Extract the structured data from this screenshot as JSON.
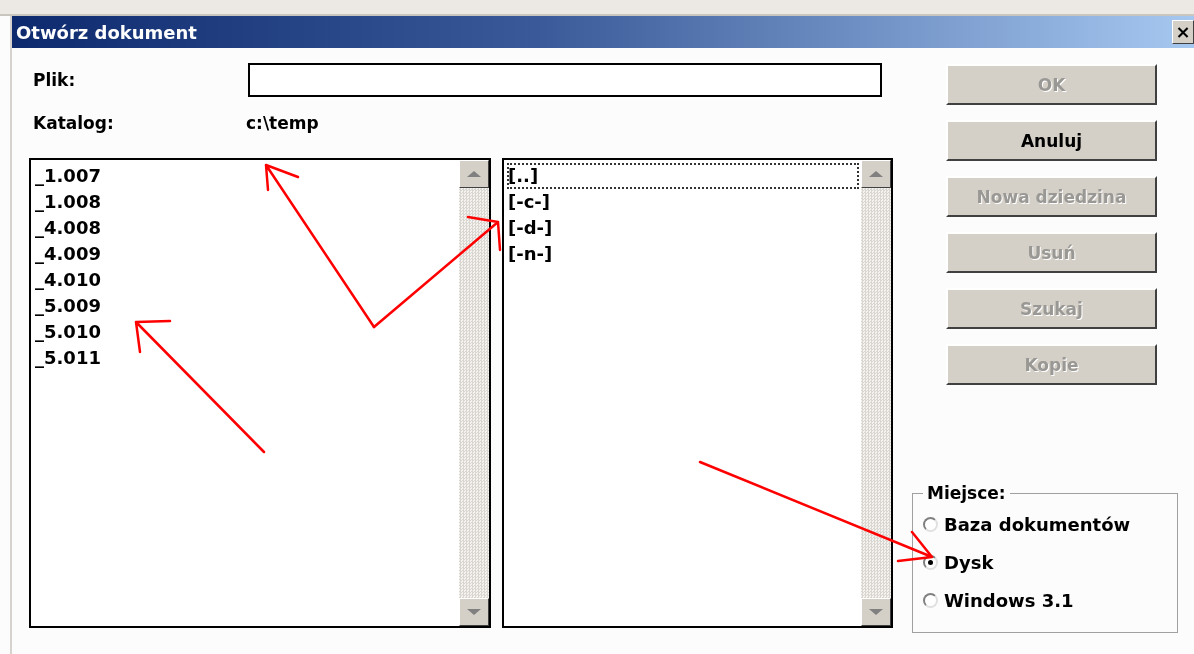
{
  "window": {
    "title": "Otwórz dokument",
    "close": "×"
  },
  "file": {
    "label": "Plik:"
  },
  "directory": {
    "label": "Katalog:",
    "path": "c:\\temp"
  },
  "files": [
    {
      "name": "_1.007",
      "selected": false
    },
    {
      "name": "_1.008",
      "selected": false
    },
    {
      "name": "_4.008",
      "selected": false
    },
    {
      "name": "_4.009",
      "selected": false
    },
    {
      "name": "_4.010",
      "selected": false
    },
    {
      "name": "_5.009",
      "selected": false
    },
    {
      "name": "_5.010",
      "selected": false
    },
    {
      "name": "_5.011",
      "selected": false
    }
  ],
  "directories": [
    {
      "name": "[..]",
      "selected": true
    },
    {
      "name": "[-c-]",
      "selected": false
    },
    {
      "name": "[-d-]",
      "selected": false
    },
    {
      "name": "[-n-]",
      "selected": false
    }
  ],
  "buttons": [
    {
      "label": "OK",
      "disabled": true
    },
    {
      "label": "Anuluj",
      "disabled": false
    },
    {
      "label": "Nowa dziedzina",
      "disabled": true
    },
    {
      "label": "Usuń",
      "disabled": true
    },
    {
      "label": "Szukaj",
      "disabled": true
    },
    {
      "label": "Kopie",
      "disabled": true
    }
  ],
  "location": {
    "title": "Miejsce:",
    "options": [
      {
        "label": "Baza dokumentów",
        "selected": false
      },
      {
        "label": "Dysk",
        "selected": true
      },
      {
        "label": "Windows 3.1",
        "selected": false
      }
    ]
  }
}
